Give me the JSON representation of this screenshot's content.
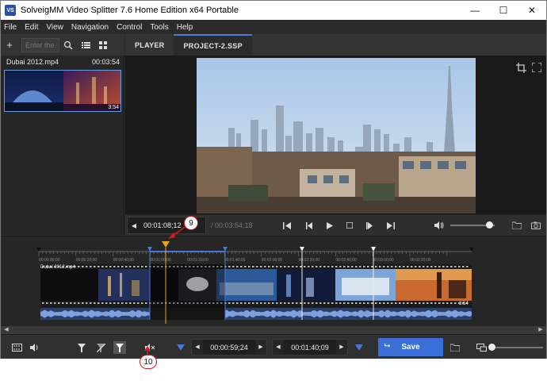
{
  "window": {
    "app_icon_text": "VS",
    "title": "SolveigMM Video Splitter 7.6 Home Edition x64 Portable",
    "controls": {
      "minimize": "—",
      "maximize": "☐",
      "close": "✕"
    }
  },
  "menu": [
    "File",
    "Edit",
    "View",
    "Navigation",
    "Control",
    "Tools",
    "Help"
  ],
  "left_panel": {
    "add_label": "+",
    "search_placeholder": "Enter the",
    "file_name": "Dubai 2012.mp4",
    "file_duration": "00:03:54",
    "thumb_duration": "3:54"
  },
  "tabs": [
    {
      "label": "PLAYER",
      "active": false
    },
    {
      "label": "PROJECT-2.SSP",
      "active": true
    }
  ],
  "player_bar": {
    "current_time": "00:01:08;12",
    "total_time": "/ 00:03:54;18",
    "volume_fraction": 0.88
  },
  "timeline": {
    "tick_labels": [
      "00:00:00;00",
      "00:00:20;00",
      "00:00:40;00",
      "00:01:00;00",
      "00:01:20;00",
      "00:01:40;00",
      "00:02:00;00",
      "00:02:20;00",
      "00:02:40;00",
      "00:03:00;00",
      "00:03:20;00"
    ],
    "clip_name": "Dubai 2012.mp4",
    "clip_duration": "3:54"
  },
  "bottom_toolbar": {
    "start_time": "00:00:59;24",
    "end_time": "00:01:40;09",
    "save_label": "Save",
    "zoom_fraction": 0.04
  },
  "annotations": [
    "9",
    "10"
  ],
  "icons": {
    "search": "search-icon",
    "list_view": "list-view-icon",
    "grid_view": "grid-view-icon",
    "crop": "crop-icon",
    "fullscreen": "fullscreen-icon",
    "folder": "folder-icon",
    "snapshot": "camera-icon"
  },
  "colors": {
    "accent": "#3a6fd8",
    "marker_orange": "#e8a21c",
    "selection_blue": "#4a78d8",
    "annotation_red": "#d21c1c"
  }
}
